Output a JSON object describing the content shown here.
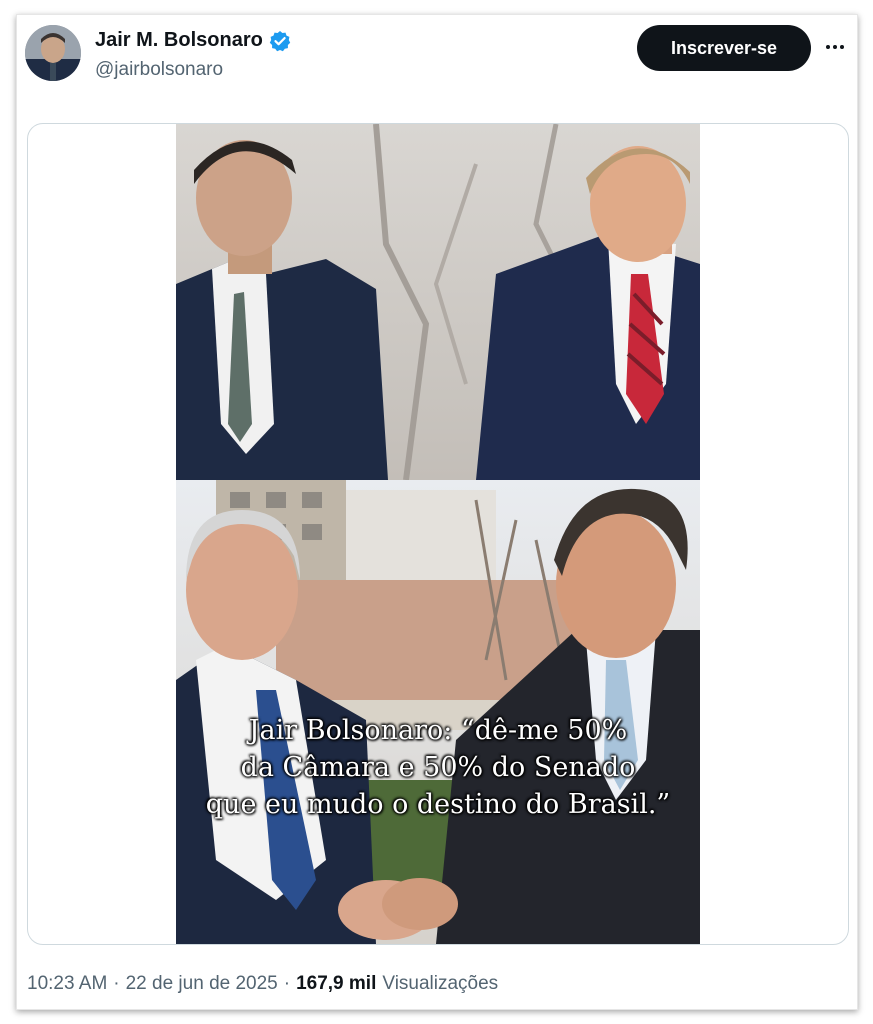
{
  "author": {
    "display_name": "Jair M. Bolsonaro",
    "handle": "@jairbolsonaro",
    "verified": true,
    "verified_color": "#1d9bf0"
  },
  "actions": {
    "subscribe_label": "Inscrever-se",
    "more_icon": "more-horizontal-icon"
  },
  "media": {
    "caption": "Jair Bolsonaro: “dê-me 50%\nda Câmara e 50% do Senado\nque eu mudo o destino do Brasil.”"
  },
  "footer": {
    "time": "10:23 AM",
    "separator": "·",
    "date": "22 de jun de 2025",
    "views_count": "167,9 mil",
    "views_label": "Visualizações"
  },
  "colors": {
    "button_bg": "#0f1419",
    "secondary_text": "#536471",
    "border": "#cfd9de"
  }
}
